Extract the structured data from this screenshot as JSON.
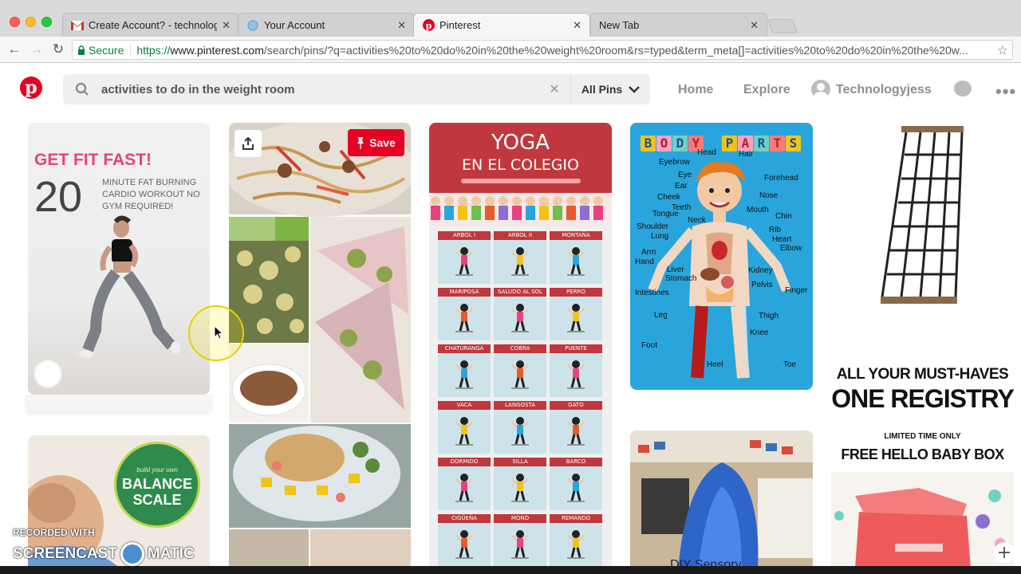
{
  "browser": {
    "tabs": [
      {
        "title": "Create Account? - technology",
        "icon": "gmail-icon",
        "active": false
      },
      {
        "title": "Your Account",
        "icon": "globe-icon",
        "active": false
      },
      {
        "title": "Pinterest",
        "icon": "pinterest-icon",
        "active": true
      },
      {
        "title": "New Tab",
        "icon": "",
        "active": false
      }
    ],
    "secure_label": "Secure",
    "url_scheme": "https://",
    "url_host": "www.pinterest.com",
    "url_path": "/search/pins/?q=activities%20to%20do%20in%20the%20weight%20room&rs=typed&term_meta[]=activities%20to%20do%20in%20the%20w..."
  },
  "header": {
    "search_query": "activities to do in the weight room",
    "filter_label": "All Pins",
    "nav_home": "Home",
    "nav_explore": "Explore",
    "username": "Technologyjess"
  },
  "pins": {
    "save_label": "Save",
    "fitness": {
      "headline": "GET FIT FAST!",
      "number": "20",
      "detail": "MINUTE FAT BURNING CARDIO WORKOUT NO GYM REQUIRED!"
    },
    "yoga": {
      "title": "YOGA",
      "subtitle": "EN EL COLEGIO",
      "poses": [
        "ARBOL I",
        "ARBOL II",
        "MONTAÑA",
        "MARIPOSA",
        "SALUDO AL SOL",
        "PERRO",
        "CHATURANGA",
        "COBRA",
        "PUENTE",
        "VACA",
        "LANGOSTA",
        "GATO",
        "DORMIDO",
        "SILLA",
        "BARCO",
        "CIGÜEÑA",
        "MONO",
        "REMANDO"
      ]
    },
    "body": {
      "letters": [
        "B",
        "O",
        "D",
        "Y",
        "P",
        "A",
        "R",
        "T",
        "S"
      ],
      "labels": [
        "Head",
        "Hair",
        "Eyebrow",
        "Forehead",
        "Eye",
        "Ear",
        "Nose",
        "Cheek",
        "Teeth",
        "Mouth",
        "Tongue",
        "Chin",
        "Neck",
        "Shoulder",
        "Rib",
        "Heart",
        "Lung",
        "Elbow",
        "Arm",
        "Hand",
        "Liver",
        "Kidney",
        "Stomach",
        "Pelvis",
        "Intestines",
        "Finger",
        "Leg",
        "Thigh",
        "Knee",
        "Foot",
        "Heel",
        "Toe"
      ]
    },
    "registry": {
      "line1": "ALL YOUR MUST-HAVES",
      "line2": "ONE REGISTRY",
      "line3": "LIMITED TIME ONLY",
      "line4": "FREE HELLO BABY BOX"
    },
    "balance": {
      "small": "build your own",
      "big": "BALANCE SCALE"
    },
    "diy": {
      "text": "DIY Sensory"
    }
  },
  "watermark": {
    "line1": "RECORDED WITH",
    "line2a": "SCREENCAST",
    "line2b": "MATIC"
  },
  "colors": {
    "pinterest_red": "#e60023",
    "yoga_red": "#c0383d",
    "body_blue": "#2aa5dc"
  }
}
